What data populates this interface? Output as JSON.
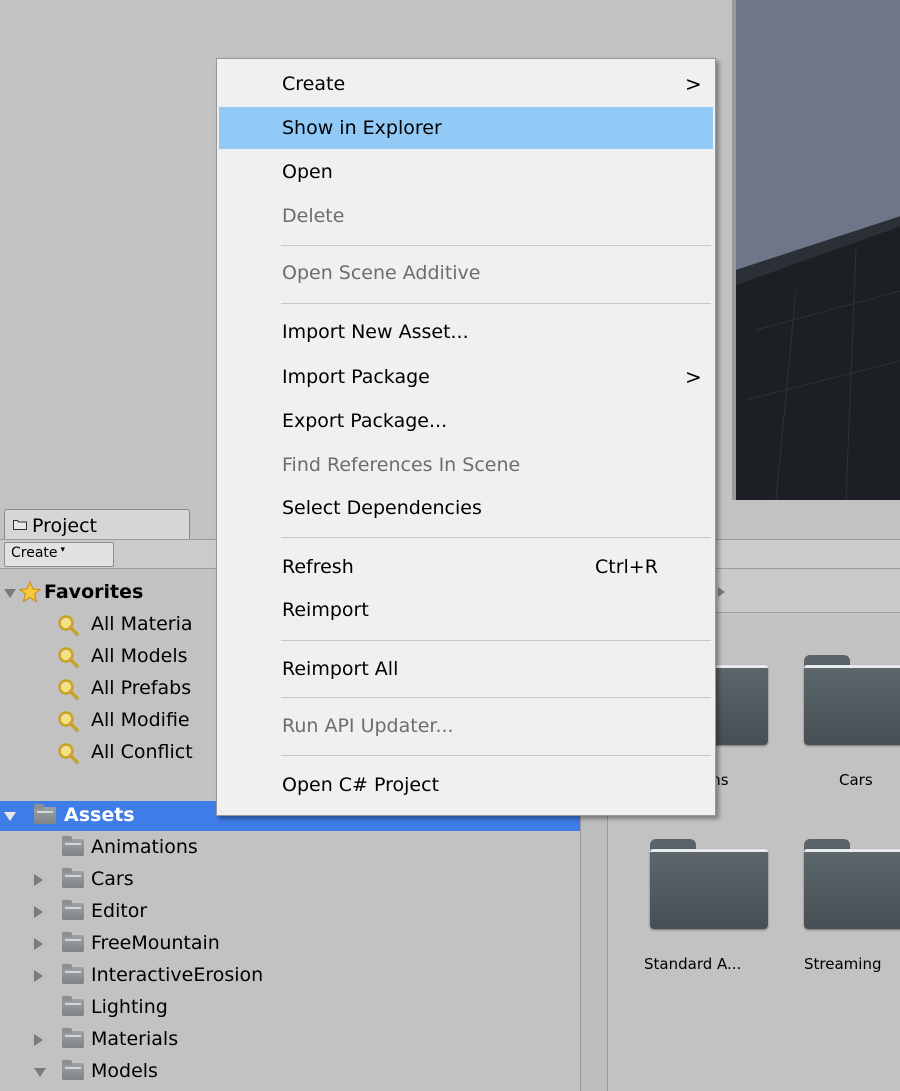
{
  "project_panel": {
    "tab_label": "Project",
    "create_button": "Create",
    "create_caret": "▾"
  },
  "tree": {
    "favorites": {
      "label": "Favorites",
      "items": [
        "All Materia",
        "All Models",
        "All Prefabs",
        "All Modifie",
        "All Conflict"
      ]
    },
    "assets": {
      "label": "Assets",
      "children": [
        {
          "label": "Animations",
          "expandable": false
        },
        {
          "label": "Cars",
          "expandable": true
        },
        {
          "label": "Editor",
          "expandable": true
        },
        {
          "label": "FreeMountain",
          "expandable": true
        },
        {
          "label": "InteractiveErosion",
          "expandable": true
        },
        {
          "label": "Lighting",
          "expandable": false
        },
        {
          "label": "Materials",
          "expandable": true
        },
        {
          "label": "Models",
          "expandable": true,
          "expanded": true
        }
      ]
    }
  },
  "grid": {
    "items": [
      {
        "label": "tions"
      },
      {
        "label": "Cars"
      },
      {
        "label": "Standard A..."
      },
      {
        "label": "Streaming"
      }
    ]
  },
  "context_menu": {
    "items": [
      {
        "label": "Create",
        "submenu_arrow": ">",
        "enabled": true
      },
      {
        "label": "Show in Explorer",
        "enabled": true,
        "highlighted": true
      },
      {
        "label": "Open",
        "enabled": true
      },
      {
        "label": "Delete",
        "enabled": false
      },
      {
        "label": "Open Scene Additive",
        "enabled": false
      },
      {
        "label": "Import New Asset...",
        "enabled": true
      },
      {
        "label": "Import Package",
        "submenu_arrow": ">",
        "enabled": true
      },
      {
        "label": "Export Package...",
        "enabled": true
      },
      {
        "label": "Find References In Scene",
        "enabled": false
      },
      {
        "label": "Select Dependencies",
        "enabled": true
      },
      {
        "label": "Refresh",
        "shortcut": "Ctrl+R",
        "enabled": true
      },
      {
        "label": "Reimport",
        "enabled": true
      },
      {
        "label": "Reimport All",
        "enabled": true
      },
      {
        "label": "Run API Updater...",
        "enabled": false
      },
      {
        "label": "Open C# Project",
        "enabled": true
      }
    ]
  },
  "colors": {
    "menu_highlight": "#91c9f7",
    "selection": "#3e7ce8",
    "panel_bg": "#c2c2c2"
  }
}
